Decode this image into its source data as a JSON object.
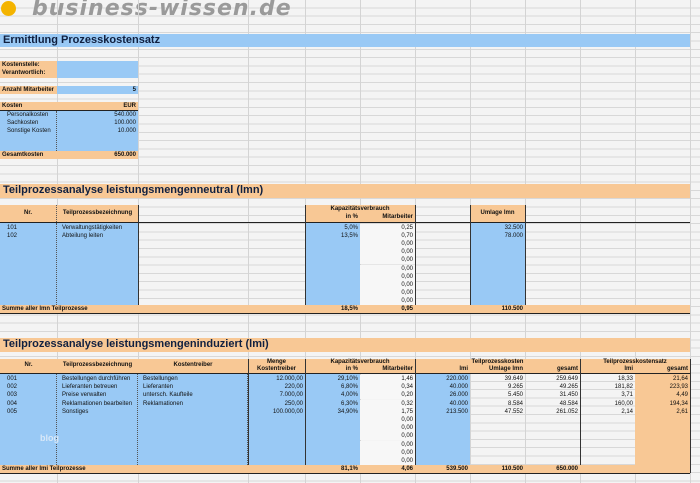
{
  "logo": {
    "text": "business-wissen.de",
    "watermark": "blog"
  },
  "title": "Ermittlung Prozesskostensatz",
  "info": {
    "kostenstelle_label": "Kostenstelle:",
    "verantwortlich_label": "Verantwortlich:",
    "mitarbeiter_label": "Anzahl Mitarbeiter",
    "mitarbeiter_value": "5"
  },
  "kosten": {
    "header": "Kosten",
    "currency": "EUR",
    "items": [
      {
        "label": "Personalkosten",
        "value": "540.000"
      },
      {
        "label": "Sachkosten",
        "value": "100.000"
      },
      {
        "label": "Sonstige Kosten",
        "value": "10.000"
      }
    ],
    "total_label": "Gesamtkosten",
    "total_value": "650.000"
  },
  "lmn": {
    "title": "Teilprozessanalyse leistungsmengenneutral (lmn)",
    "headers": {
      "nr": "Nr.",
      "bez": "Teilprozessbezeichnung",
      "kap": "Kapazitätsverbrauch",
      "inp": "in %",
      "ma": "Mitarbeiter",
      "umlage": "Umlage lmn"
    },
    "rows": [
      {
        "nr": "101",
        "bez": "Verwaltungstätigkeiten",
        "inp": "5,0%",
        "ma": "0,25",
        "umlage": "32.500"
      },
      {
        "nr": "102",
        "bez": "Abteilung leiten",
        "inp": "13,5%",
        "ma": "0,70",
        "umlage": "78.000"
      },
      {
        "ma": "0,00"
      },
      {
        "ma": "0,00"
      },
      {
        "ma": "0,00"
      },
      {
        "ma": "0,00"
      },
      {
        "ma": "0,00"
      },
      {
        "ma": "0,00"
      },
      {
        "ma": "0,00"
      },
      {
        "ma": "0,00"
      }
    ],
    "sum": {
      "label": "Summe aller lmn Teilprozesse",
      "inp": "18,5%",
      "ma": "0,95",
      "umlage": "110.500"
    }
  },
  "lmi": {
    "title": "Teilprozessanalyse leistungsmengeninduziert (lmi)",
    "headers": {
      "nr": "Nr.",
      "bez": "Teilprozessbezeichnung",
      "kt": "Kostentreiber",
      "menge1": "Menge",
      "menge2": "Kostentreiber",
      "kap": "Kapazitätsverbrauch",
      "inp": "in %",
      "ma": "Mitarbeiter",
      "tk": "Teilprozesskosten",
      "lmi": "lmi",
      "umlage": "Umlage lmn",
      "gesamt": "gesamt",
      "tks": "Teilprozesskostensatz",
      "s_lmi": "lmi",
      "s_gesamt": "gesamt"
    },
    "rows": [
      {
        "nr": "001",
        "bez": "Bestellungen durchführen",
        "kt": "Bestellungen",
        "menge": "12.000,00",
        "inp": "29,10%",
        "ma": "1,46",
        "lmi": "220.000",
        "umlage": "39.649",
        "gesamt": "259.649",
        "s_lmi": "18,33",
        "s_gesamt": "21,64"
      },
      {
        "nr": "002",
        "bez": "Lieferanten betreuen",
        "kt": "Lieferanten",
        "menge": "220,00",
        "inp": "6,80%",
        "ma": "0,34",
        "lmi": "40.000",
        "umlage": "9.265",
        "gesamt": "49.265",
        "s_lmi": "181,82",
        "s_gesamt": "223,93"
      },
      {
        "nr": "003",
        "bez": "Preise verwalten",
        "kt": "untersch. Kaufteile",
        "menge": "7.000,00",
        "inp": "4,00%",
        "ma": "0,20",
        "lmi": "26.000",
        "umlage": "5.450",
        "gesamt": "31.450",
        "s_lmi": "3,71",
        "s_gesamt": "4,49"
      },
      {
        "nr": "004",
        "bez": "Reklamationen bearbeiten",
        "kt": "Reklamationen",
        "menge": "250,00",
        "inp": "6,30%",
        "ma": "0,32",
        "lmi": "40.000",
        "umlage": "8.584",
        "gesamt": "48.584",
        "s_lmi": "160,00",
        "s_gesamt": "194,34"
      },
      {
        "nr": "005",
        "bez": "Sonstiges",
        "menge": "100.000,00",
        "inp": "34,90%",
        "ma": "1,75",
        "lmi": "213.500",
        "umlage": "47.552",
        "gesamt": "261.052",
        "s_lmi": "2,14",
        "s_gesamt": "2,61"
      },
      {
        "ma": "0,00"
      },
      {
        "ma": "0,00"
      },
      {
        "ma": "0,00"
      },
      {
        "ma": "0,00"
      },
      {
        "ma": "0,00"
      },
      {
        "ma": "0,00"
      }
    ],
    "sum": {
      "label": "Summe aller lmi Teilprozesse",
      "inp": "81,1%",
      "ma": "4,06",
      "lmi": "539.500",
      "umlage": "110.500",
      "gesamt": "650.000"
    }
  }
}
